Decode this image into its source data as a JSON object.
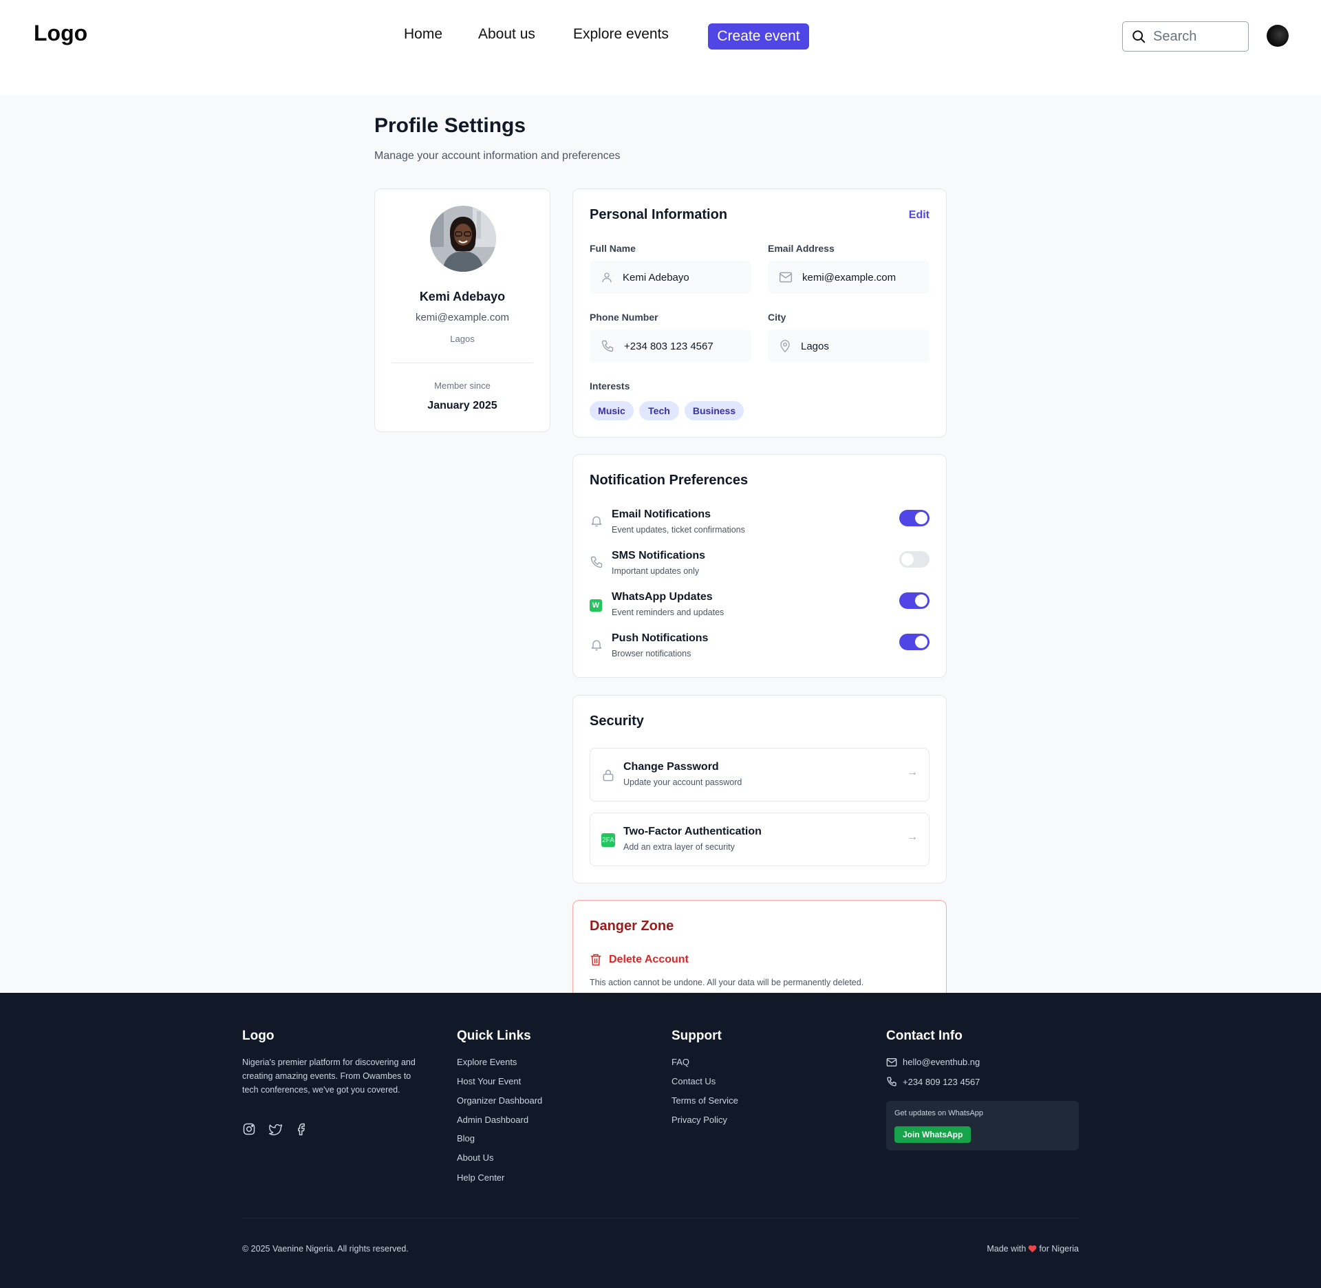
{
  "header": {
    "logo": "Logo",
    "nav": [
      "Home",
      "About us",
      "Explore events"
    ],
    "create_button": "Create event",
    "search_placeholder": "Search"
  },
  "page": {
    "title": "Profile Settings",
    "subtitle": "Manage your account information and preferences"
  },
  "profile": {
    "name": "Kemi Adebayo",
    "email": "kemi@example.com",
    "city": "Lagos",
    "member_since_label": "Member since",
    "member_since": "January 2025"
  },
  "personal_info": {
    "title": "Personal Information",
    "edit_label": "Edit",
    "full_name_label": "Full Name",
    "full_name": "Kemi Adebayo",
    "email_label": "Email Address",
    "email": "kemi@example.com",
    "phone_label": "Phone Number",
    "phone": "+234 803 123 4567",
    "city_label": "City",
    "city": "Lagos",
    "interests_label": "Interests",
    "interests": [
      "Music",
      "Tech",
      "Business"
    ]
  },
  "notifications": {
    "title": "Notification Preferences",
    "items": [
      {
        "title": "Email Notifications",
        "desc": "Event updates, ticket confirmations",
        "enabled": true,
        "icon": "bell-icon"
      },
      {
        "title": "SMS Notifications",
        "desc": "Important updates only",
        "enabled": false,
        "icon": "phone-icon"
      },
      {
        "title": "WhatsApp Updates",
        "desc": "Event reminders and updates",
        "enabled": true,
        "icon": "whatsapp-icon",
        "badge": "W"
      },
      {
        "title": "Push Notifications",
        "desc": "Browser notifications",
        "enabled": true,
        "icon": "bell-icon"
      }
    ]
  },
  "security": {
    "title": "Security",
    "items": [
      {
        "title": "Change Password",
        "desc": "Update your account password",
        "arrow": "→"
      },
      {
        "title": "Two-Factor Authentication",
        "desc": "Add an extra layer of security",
        "badge": "2FA",
        "arrow": "→"
      }
    ]
  },
  "danger": {
    "title": "Danger Zone",
    "delete_label": "Delete Account",
    "desc": "This action cannot be undone. All your data will be permanently deleted."
  },
  "footer": {
    "logo": "Logo",
    "description": "Nigeria's premier platform for discovering and creating amazing events. From Owambes to tech conferences, we've got you covered.",
    "quick_links_title": "Quick Links",
    "quick_links": [
      "Explore Events",
      "Host Your Event",
      "Organizer Dashboard",
      "Admin Dashboard",
      "Blog",
      "About Us",
      "Help Center"
    ],
    "support_title": "Support",
    "support_links": [
      "FAQ",
      "Contact Us",
      "Terms of Service",
      "Privacy Policy"
    ],
    "contact_title": "Contact Info",
    "contact_email": "hello@eventhub.ng",
    "contact_phone": "+234 809 123 4567",
    "whatsapp_label": "Get updates on WhatsApp",
    "whatsapp_button": "Join WhatsApp",
    "copyright": "© 2025 Vaenine Nigeria. All rights reserved.",
    "made_with_prefix": "Made with",
    "made_with_suffix": "for Nigeria"
  },
  "colors": {
    "accent": "#4f46e5",
    "danger": "#dc2626",
    "success": "#22c55e",
    "footer_bg": "#111827",
    "page_bg": "#f8f9fb"
  }
}
